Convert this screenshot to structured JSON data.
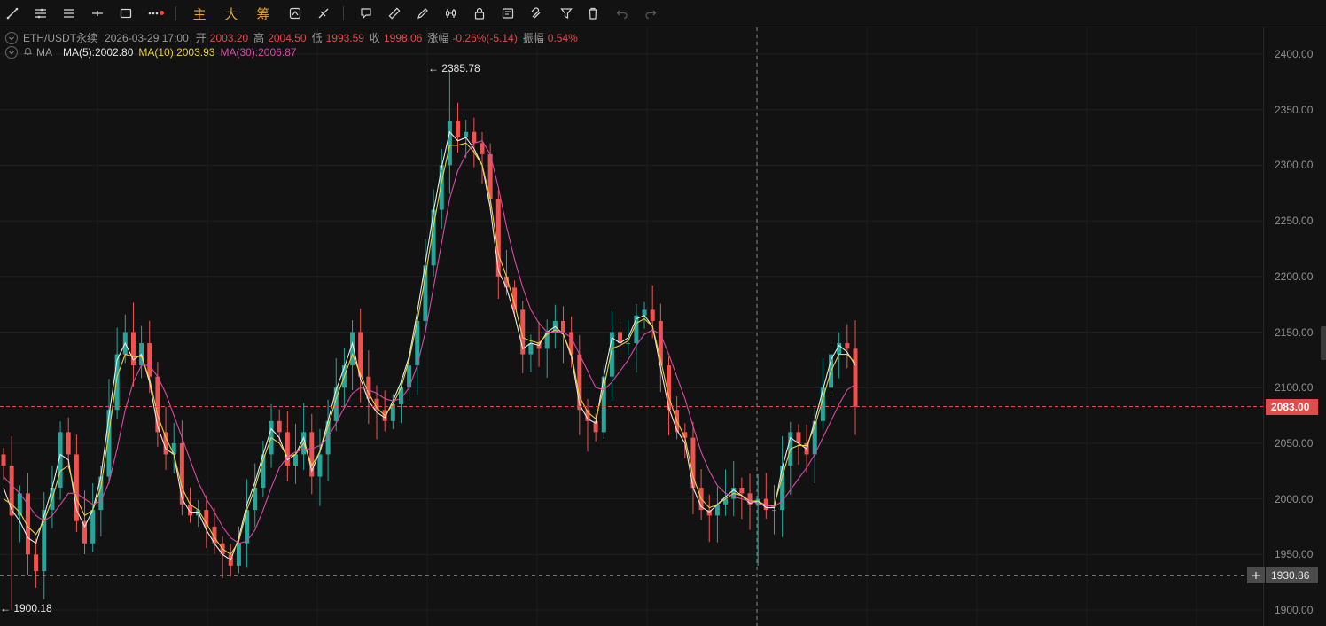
{
  "toolbar": {
    "items": [
      "trend-line-tool",
      "parallel-lines-tool",
      "horizontal-lines-tool",
      "horizontal-ray-tool",
      "rectangle-tool",
      "more-tools",
      "separator",
      "主",
      "大",
      "筹",
      "separator",
      "replay-tool",
      "measure-tool",
      "separator",
      "callout-tool",
      "ruler-tool",
      "highlighter-tool",
      "pattern-tool",
      "lock-tool",
      "alert-tool",
      "magnet-tool",
      "filter-tool",
      "delete-tool",
      "undo-tool",
      "redo-tool"
    ],
    "labels": {
      "zhu": "主",
      "da": "大",
      "chou": "筹"
    }
  },
  "legend": {
    "symbol": "ETH/USDT永续",
    "datetime": "2026-03-29 17:00",
    "open_label": "开",
    "open": "2003.20",
    "high_label": "高",
    "high": "2004.50",
    "low_label": "低",
    "low": "1993.59",
    "close_label": "收",
    "close": "1998.06",
    "change_label": "涨幅",
    "change": "-0.26%(-5.14)",
    "amplitude_label": "振幅",
    "amplitude": "0.54%",
    "ma_title": "MA",
    "ma5": "MA(5):2002.80",
    "ma10": "MA(10):2003.93",
    "ma30": "MA(30):2006.87"
  },
  "colors": {
    "up": "#26a69a",
    "down": "#ef5350",
    "ma5": "#e8e8e8",
    "ma10": "#e8d03a",
    "ma30": "#d64aa6",
    "background": "#121212",
    "grid": "#1f1f1f",
    "current_price": "#e04b4b"
  },
  "markers": {
    "high_label": "← 2385.78",
    "low_label": "← 1900.18"
  },
  "price_axis": {
    "ticks": [
      "2400.00",
      "2350.00",
      "2300.00",
      "2250.00",
      "2200.00",
      "2150.00",
      "2100.00",
      "2050.00",
      "2000.00",
      "1950.00",
      "1900.00"
    ],
    "current_price": "2083.00",
    "crosshair_price": "1930.86"
  },
  "chart_data": {
    "type": "candlestick",
    "symbol": "ETH/USDT永续",
    "ylim": [
      1880,
      2420
    ],
    "series": [
      {
        "name": "close",
        "values": [
          2030,
          1985,
          2005,
          1950,
          1935,
          1990,
          2010,
          2060,
          2040,
          1980,
          1960,
          1990,
          2020,
          2080,
          2130,
          2150,
          2120,
          2140,
          2110,
          2060,
          2040,
          2050,
          1995,
          1985,
          1990,
          1975,
          1960,
          1950,
          1940,
          1960,
          1990,
          2010,
          2040,
          2070,
          2060,
          2030,
          2040,
          2060,
          2020,
          2040,
          2070,
          2100,
          2120,
          2150,
          2110,
          2090,
          2080,
          2070,
          2085,
          2100,
          2120,
          2160,
          2210,
          2260,
          2300,
          2340,
          2325,
          2330,
          2320,
          2310,
          2270,
          2200,
          2190,
          2170,
          2130,
          2140,
          2135,
          2150,
          2160,
          2150,
          2130,
          2080,
          2070,
          2060,
          2110,
          2150,
          2140,
          2140,
          2165,
          2170,
          2160,
          2120,
          2080,
          2060,
          2055,
          2010,
          1990,
          1985,
          1995,
          2000,
          2010,
          2005,
          1995,
          2000,
          1990,
          1990,
          2030,
          2060,
          2050,
          2040,
          2070,
          2100,
          2130,
          2140,
          2135,
          2083
        ]
      },
      {
        "name": "MA(5)",
        "values": [
          2010,
          1990,
          1980,
          1965,
          1960,
          1985,
          2010,
          2040,
          2035,
          1990,
          1975,
          1990,
          2020,
          2075,
          2125,
          2140,
          2125,
          2130,
          2105,
          2065,
          2045,
          2040,
          2000,
          1988,
          1988,
          1972,
          1960,
          1950,
          1945,
          1965,
          1995,
          2015,
          2040,
          2063,
          2055,
          2035,
          2040,
          2055,
          2025,
          2043,
          2070,
          2098,
          2118,
          2140,
          2108,
          2088,
          2078,
          2073,
          2088,
          2105,
          2128,
          2168,
          2212,
          2258,
          2298,
          2330,
          2322,
          2325,
          2315,
          2300,
          2262,
          2205,
          2190,
          2165,
          2135,
          2140,
          2138,
          2150,
          2155,
          2148,
          2128,
          2085,
          2072,
          2068,
          2110,
          2145,
          2140,
          2145,
          2162,
          2165,
          2155,
          2118,
          2082,
          2062,
          2050,
          2010,
          1993,
          1988,
          1995,
          2002,
          2008,
          2003,
          1996,
          1998,
          1992,
          1992,
          2028,
          2055,
          2050,
          2045,
          2070,
          2098,
          2125,
          2138,
          2132,
          2120
        ]
      },
      {
        "name": "MA(10)",
        "values": [
          2000,
          1995,
          1988,
          1975,
          1968,
          1980,
          2000,
          2025,
          2030,
          2000,
          1985,
          1990,
          2010,
          2060,
          2110,
          2130,
          2128,
          2128,
          2108,
          2075,
          2055,
          2040,
          2010,
          1995,
          1990,
          1978,
          1965,
          1955,
          1950,
          1962,
          1990,
          2010,
          2035,
          2055,
          2050,
          2038,
          2040,
          2050,
          2030,
          2042,
          2065,
          2090,
          2110,
          2130,
          2112,
          2095,
          2082,
          2075,
          2085,
          2100,
          2125,
          2160,
          2200,
          2245,
          2285,
          2318,
          2318,
          2320,
          2312,
          2300,
          2270,
          2220,
          2200,
          2175,
          2145,
          2142,
          2140,
          2148,
          2152,
          2148,
          2130,
          2092,
          2078,
          2072,
          2100,
          2135,
          2138,
          2142,
          2158,
          2162,
          2155,
          2125,
          2092,
          2070,
          2055,
          2020,
          2000,
          1992,
          1995,
          2000,
          2005,
          2003,
          1998,
          1998,
          1994,
          1994,
          2020,
          2045,
          2048,
          2048,
          2065,
          2090,
          2115,
          2130,
          2130,
          2122
        ]
      },
      {
        "name": "MA(30)",
        "values": [
          2020,
          2012,
          2005,
          1995,
          1985,
          1980,
          1985,
          1995,
          2005,
          2005,
          2000,
          1995,
          1998,
          2015,
          2045,
          2080,
          2105,
          2120,
          2120,
          2110,
          2095,
          2075,
          2055,
          2035,
          2015,
          2000,
          1988,
          1975,
          1965,
          1960,
          1962,
          1972,
          1990,
          2010,
          2028,
          2038,
          2042,
          2045,
          2045,
          2048,
          2055,
          2068,
          2082,
          2095,
          2100,
          2098,
          2095,
          2090,
          2088,
          2090,
          2100,
          2120,
          2150,
          2190,
          2230,
          2270,
          2295,
          2310,
          2320,
          2322,
          2310,
          2280,
          2245,
          2215,
          2190,
          2170,
          2158,
          2150,
          2150,
          2150,
          2145,
          2130,
          2115,
          2100,
          2098,
          2105,
          2115,
          2125,
          2138,
          2148,
          2152,
          2148,
          2130,
          2110,
          2090,
          2065,
          2042,
          2025,
          2012,
          2005,
          2002,
          2000,
          1998,
          1996,
          1994,
          1993,
          1998,
          2008,
          2018,
          2028,
          2040,
          2055,
          2070,
          2085,
          2098,
          2103
        ]
      }
    ],
    "annotations": {
      "max": 2385.78,
      "min": 1900.18,
      "current": 2083.0,
      "crosshair": 1930.86
    }
  }
}
